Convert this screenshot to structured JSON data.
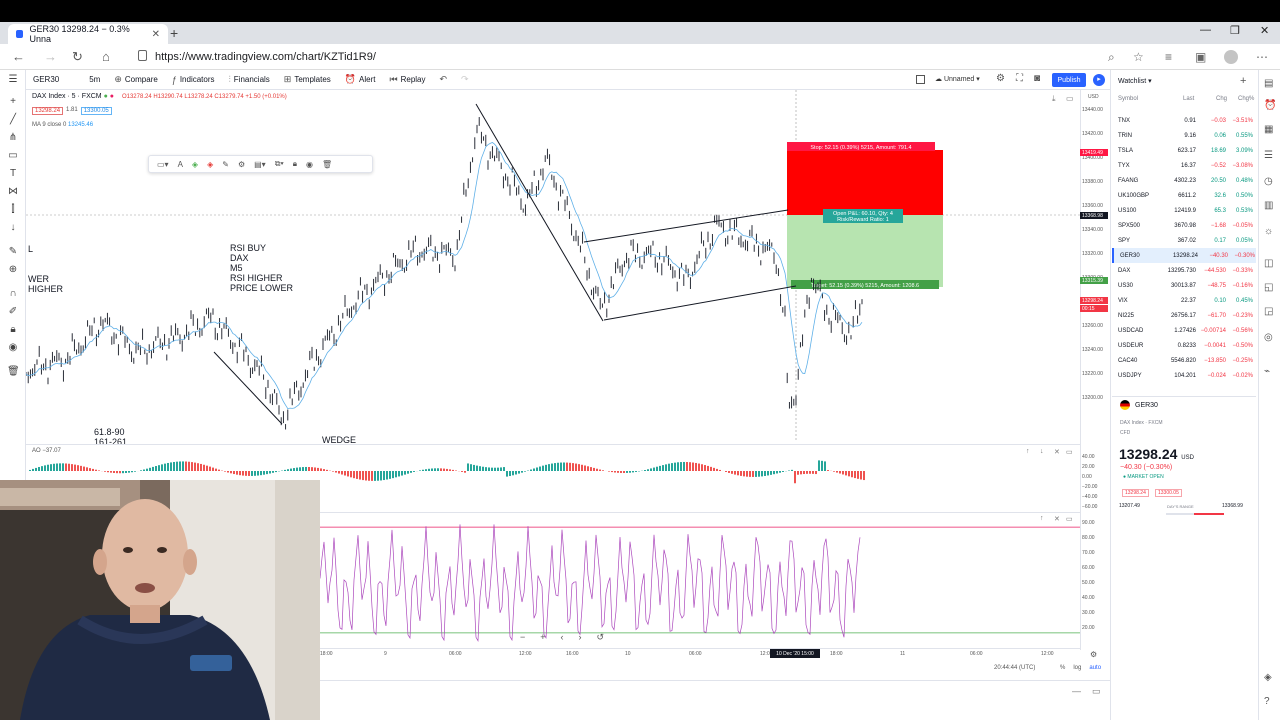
{
  "browser": {
    "tab_title": "GER30 13298.24 − 0.3% Unna",
    "url": "https://www.tradingview.com/chart/KZTid1R9/"
  },
  "toolbar": {
    "symbol": "GER30",
    "interval": "5m",
    "compare": "Compare",
    "indicators": "Indicators",
    "financials": "Financials",
    "templates": "Templates",
    "alert": "Alert",
    "replay": "Replay",
    "layout_name": "Unnamed",
    "publish": "Publish"
  },
  "legend": {
    "title": "DAX Index · 5 · FXCM",
    "ohlc": "O13278.24 H13290.74 L13278.24 C13279.74 +1.50 (+0.01%)",
    "sell_box": "13298.24",
    "spread": "1.81",
    "buy_box": "13300.05",
    "ma": "MA 9 close 0",
    "ma_value": "13245.46"
  },
  "annotations": {
    "rsi_note": "RSI BUY\nDAX\nM5\nRSI HIGHER\nPRICE LOWER",
    "left_note_1": "L",
    "left_note_2": "WER\nHIGHER",
    "fib_note": "61.8-90\n161-261",
    "wedge": "WEDGE"
  },
  "position": {
    "stop": "Stop: 52.15 (0.39%) 5215, Amount: 791.4",
    "open": "Open P&L: 60.10, Qty: 4",
    "rr": "Risk/Reward Ratio: 1",
    "target": "Target: 52.15 (0.39%) 5215, Amount: 1208.6"
  },
  "price_axis": {
    "labels": [
      "13440.00",
      "13420.00",
      "13400.00",
      "13380.00",
      "13360.00",
      "13340.00",
      "13320.00",
      "13300.00",
      "13280.00",
      "13260.00",
      "13240.00",
      "13220.00",
      "13200.00"
    ],
    "stop_tag": "13419.49",
    "cross_tag": "13368.98",
    "target_tag": "13315.39",
    "current_tag": "13298.24",
    "countdown": "00:15",
    "unit": "USD"
  },
  "ao": {
    "label": "AO −37.07",
    "axis": [
      "40.00",
      "20.00",
      "0.00",
      "−20.00",
      "−40.00",
      "−60.00"
    ]
  },
  "rsi": {
    "axis": [
      "90.00",
      "80.00",
      "70.00",
      "60.00",
      "50.00",
      "40.00",
      "30.00",
      "20.00"
    ],
    "upper": 90,
    "lower": 20
  },
  "time_axis": {
    "labels": [
      "18:00",
      "9",
      "06:00",
      "12:00",
      "16:00",
      "10",
      "06:00",
      "12:00",
      "18:00",
      "11",
      "06:00",
      "12:00"
    ],
    "cursor": "10 Dec '20  15:00"
  },
  "status": {
    "clock": "20:44:44 (UTC)",
    "pct": "%",
    "log": "log",
    "auto": "auto"
  },
  "watchlist": {
    "title": "Watchlist",
    "headers": {
      "symbol": "Symbol",
      "last": "Last",
      "chg": "Chg",
      "pct": "Chg%"
    },
    "rows": [
      {
        "sym": "TNX",
        "last": "0.91",
        "chg": "−0.03",
        "pct": "−3.51%",
        "dir": "neg"
      },
      {
        "sym": "TRIN",
        "last": "9.16",
        "chg": "0.06",
        "pct": "0.55%",
        "dir": "pos"
      },
      {
        "sym": "TSLA",
        "last": "623.17",
        "chg": "18.69",
        "pct": "3.09%",
        "dir": "pos"
      },
      {
        "sym": "TYX",
        "last": "16.37",
        "chg": "−0.52",
        "pct": "−3.08%",
        "dir": "neg"
      },
      {
        "sym": "FAANG",
        "last": "4302.23",
        "chg": "20.50",
        "pct": "0.48%",
        "dir": "pos"
      },
      {
        "sym": "UK100GBP",
        "last": "6611.2",
        "chg": "32.6",
        "pct": "0.50%",
        "dir": "pos"
      },
      {
        "sym": "US100",
        "last": "12419.9",
        "chg": "65.3",
        "pct": "0.53%",
        "dir": "pos"
      },
      {
        "sym": "SPX500",
        "last": "3670.98",
        "chg": "−1.68",
        "pct": "−0.05%",
        "dir": "neg"
      },
      {
        "sym": "SPY",
        "last": "367.02",
        "chg": "0.17",
        "pct": "0.05%",
        "dir": "pos"
      },
      {
        "sym": "GER30",
        "last": "13298.24",
        "chg": "−40.30",
        "pct": "−0.30%",
        "dir": "neg",
        "sel": true
      },
      {
        "sym": "DAX",
        "last": "13295.730",
        "chg": "−44.530",
        "pct": "−0.33%",
        "dir": "neg"
      },
      {
        "sym": "US30",
        "last": "30013.87",
        "chg": "−48.75",
        "pct": "−0.16%",
        "dir": "neg"
      },
      {
        "sym": "VIX",
        "last": "22.37",
        "chg": "0.10",
        "pct": "0.45%",
        "dir": "pos"
      },
      {
        "sym": "NI225",
        "last": "26756.17",
        "chg": "−61.70",
        "pct": "−0.23%",
        "dir": "neg"
      },
      {
        "sym": "USDCAD",
        "last": "1.27426",
        "chg": "−0.00714",
        "pct": "−0.56%",
        "dir": "neg"
      },
      {
        "sym": "USDEUR",
        "last": "0.8233",
        "chg": "−0.0041",
        "pct": "−0.50%",
        "dir": "neg"
      },
      {
        "sym": "CAC40",
        "last": "5546.820",
        "chg": "−13.850",
        "pct": "−0.25%",
        "dir": "neg"
      },
      {
        "sym": "USDJPY",
        "last": "104.201",
        "chg": "−0.024",
        "pct": "−0.02%",
        "dir": "neg"
      }
    ],
    "detail": {
      "name": "GER30",
      "sub": "DAX Index · FXCM",
      "type": "CFD",
      "price": "13298.24",
      "unit": "USD",
      "change": "−40.30 (−0.30%)",
      "status": "● MARKET OPEN",
      "sell_tag": "13298.24",
      "buy_tag": "13300.05",
      "day_low": "13207.49",
      "day_range": "DAY'S RANGE",
      "day_high": "13368.99",
      "day_range_pos": 0.52
    }
  },
  "colors": {
    "accent": "#2962ff",
    "stop_zone": "#ff0000",
    "target_zone": "#b7e4b0",
    "candle": "#131722",
    "ma": "#5fb0e8",
    "rsi": "#9c27b0"
  }
}
